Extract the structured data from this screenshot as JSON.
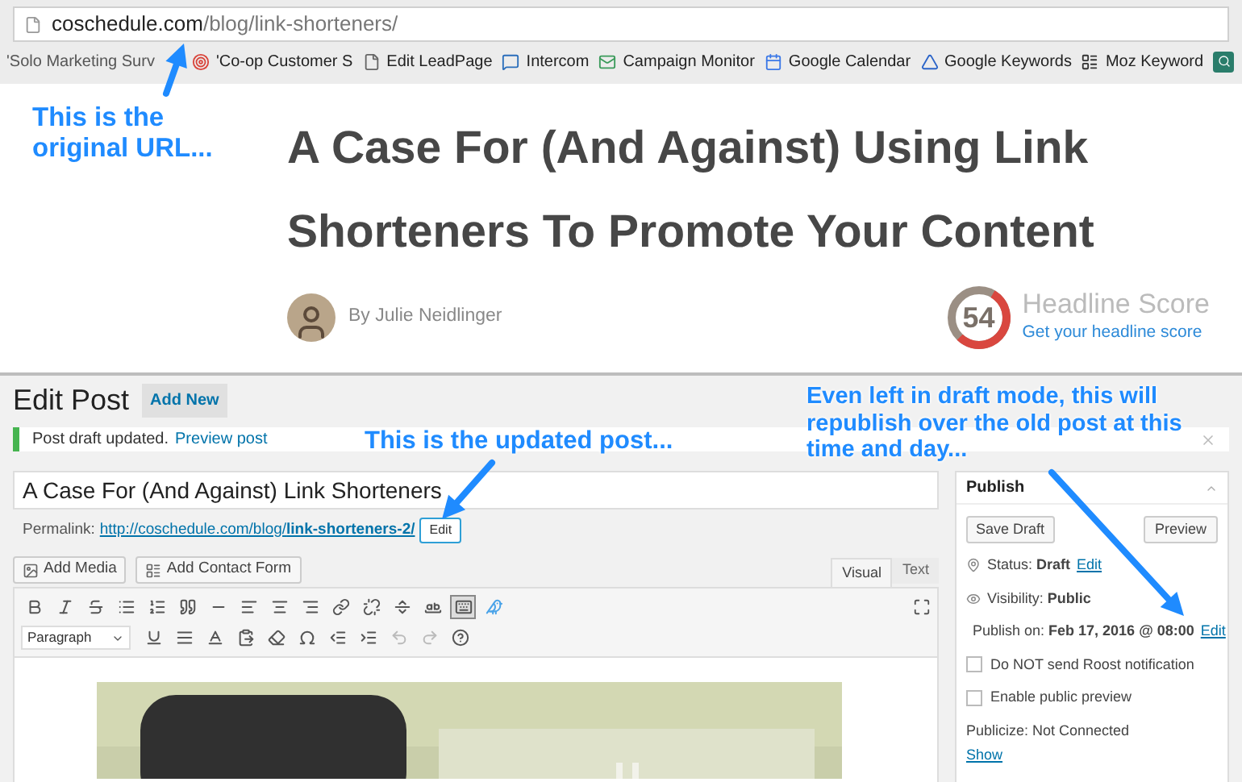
{
  "browser": {
    "url": "**coschedule.com**/blog/link-shorteners/",
    "bookmarks": [
      {
        "label": "'Solo Marketing Surv"
      },
      {
        "label": "'Co-op Customer S"
      },
      {
        "label": "Edit LeadPage"
      },
      {
        "label": "Intercom"
      },
      {
        "label": "Campaign Monitor"
      },
      {
        "label": "Google Calendar"
      },
      {
        "label": "Google Keywords"
      },
      {
        "label": "Moz Keyword"
      }
    ]
  },
  "article": {
    "title": "A Case For (And Against) Using Link Shorteners To Promote Your Content",
    "byline": "By Julie Neidlinger",
    "headline_score": {
      "score": "54",
      "level": 0.54,
      "label": "Headline Score",
      "link": "Get your headline score"
    }
  },
  "editor": {
    "heading": "Edit Post",
    "add_new": "Add New",
    "notice": {
      "text": "Post draft updated.",
      "link": "Preview post"
    },
    "post_title": "A Case For (And Against) Link Shorteners",
    "permalink": {
      "label": "Permalink:",
      "url": "http://coschedule.com/blog/**link-shorteners-2/**",
      "edit": "Edit"
    },
    "media_buttons": [
      {
        "label": "Add Media"
      },
      {
        "label": "Add Contact Form"
      }
    ],
    "mode_tabs": [
      {
        "label": "Visual",
        "selected": true
      },
      {
        "label": "Text",
        "selected": false
      }
    ],
    "format": "Paragraph",
    "toolbar_rows": [
      [
        {
          "kind": "bold",
          "pressed": false,
          "disabled": false
        },
        {
          "kind": "italic",
          "pressed": false,
          "disabled": false
        },
        {
          "kind": "strike",
          "pressed": false,
          "disabled": false
        },
        {
          "kind": "bullets",
          "pressed": false,
          "disabled": false
        },
        {
          "kind": "numbers",
          "pressed": false,
          "disabled": false
        },
        {
          "kind": "quote",
          "pressed": false,
          "disabled": false
        },
        {
          "kind": "rule",
          "pressed": false,
          "disabled": false
        },
        {
          "kind": "left",
          "pressed": false,
          "disabled": false
        },
        {
          "kind": "center",
          "pressed": false,
          "disabled": false
        },
        {
          "kind": "right",
          "pressed": false,
          "disabled": false
        },
        {
          "kind": "link",
          "pressed": false,
          "disabled": false
        },
        {
          "kind": "unlink",
          "pressed": false,
          "disabled": false
        },
        {
          "kind": "more",
          "pressed": false,
          "disabled": false
        },
        {
          "kind": "spell",
          "pressed": false,
          "disabled": false
        },
        {
          "kind": "toggle",
          "pressed": true,
          "disabled": false
        },
        {
          "kind": "bird",
          "pressed": false,
          "disabled": false
        }
      ],
      [
        {
          "kind": "underline",
          "pressed": false,
          "disabled": false
        },
        {
          "kind": "justify",
          "pressed": false,
          "disabled": false
        },
        {
          "kind": "color",
          "pressed": false,
          "disabled": false
        },
        {
          "kind": "paste",
          "pressed": false,
          "disabled": false
        },
        {
          "kind": "eraser",
          "pressed": false,
          "disabled": false
        },
        {
          "kind": "omega",
          "pressed": false,
          "disabled": false
        },
        {
          "kind": "outdent",
          "pressed": false,
          "disabled": false
        },
        {
          "kind": "indent",
          "pressed": false,
          "disabled": false
        },
        {
          "kind": "undo",
          "pressed": false,
          "disabled": true
        },
        {
          "kind": "redo",
          "pressed": false,
          "disabled": true
        },
        {
          "kind": "help",
          "pressed": false,
          "disabled": false
        }
      ]
    ]
  },
  "publish": {
    "title": "Publish",
    "save_draft": "Save Draft",
    "preview": "Preview",
    "rows": [
      {
        "text": "Status: **Draft**",
        "edit": "Edit"
      },
      {
        "text": "Visibility: **Public**"
      },
      {
        "text": "Publish on: **Feb 17, 2016 @ 08:00**",
        "edit": "Edit"
      }
    ],
    "checkboxes": [
      {
        "label": "Do NOT send Roost notification",
        "checked": false
      },
      {
        "label": "Enable public preview",
        "checked": false
      }
    ],
    "publicize": "Publicize: Not Connected",
    "show": "Show"
  },
  "annotations": [
    {
      "text": "This is the original URL..."
    },
    {
      "text": "This is the updated post..."
    },
    {
      "text": "Even left in draft mode, this will republish over the old post at this time and day..."
    }
  ]
}
